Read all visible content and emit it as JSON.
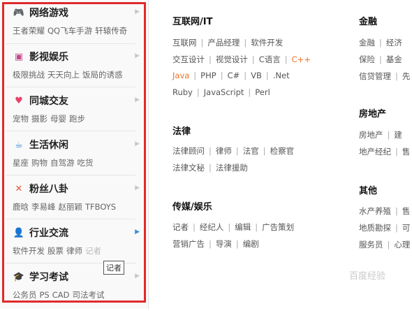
{
  "sidebar": {
    "categories": [
      {
        "title": "网络游戏",
        "subs": [
          "王者荣耀",
          "QQ飞车手游",
          "轩辕传奇"
        ],
        "icon": "gamepad-icon"
      },
      {
        "title": "影视娱乐",
        "subs": [
          "极限挑战",
          "天天向上",
          "饭局的诱惑"
        ],
        "icon": "film-icon"
      },
      {
        "title": "同城交友",
        "subs": [
          "宠物",
          "摄影",
          "母婴",
          "跑步"
        ],
        "icon": "heart-icon"
      },
      {
        "title": "生活休闲",
        "subs": [
          "星座",
          "购物",
          "自驾游",
          "吃货"
        ],
        "icon": "coffee-cup-icon"
      },
      {
        "title": "粉丝八卦",
        "subs": [
          "鹿晗",
          "李易峰",
          "赵丽颖",
          "TFBOYS"
        ],
        "icon": "fan-icon"
      },
      {
        "title": "行业交流",
        "subs": [
          "软件开发",
          "股票",
          "律师",
          "记者"
        ],
        "icon": "person-icon"
      },
      {
        "title": "学习考试",
        "subs": [
          "公务员",
          "PS",
          "CAD",
          "司法考试"
        ],
        "icon": "graduation-cap-icon"
      }
    ],
    "tooltip": "记者",
    "arrow": "▶"
  },
  "panel": {
    "it": {
      "title": "互联网/IT",
      "rows": [
        [
          "互联网",
          "产品经理",
          "软件开发"
        ],
        [
          "交互设计",
          "视觉设计",
          "C语言",
          "C++"
        ],
        [
          "Java",
          "PHP",
          "C#",
          "VB",
          ".Net"
        ],
        [
          "Ruby",
          "JavaScript",
          "Perl"
        ]
      ]
    },
    "law": {
      "title": "法律",
      "rows": [
        [
          "法律顾问",
          "律师",
          "法官",
          "检察官"
        ],
        [
          "法律文秘",
          "法律援助"
        ]
      ]
    },
    "media": {
      "title": "传媒/娱乐",
      "rows": [
        [
          "记者",
          "经纪人",
          "编辑",
          "广告策划"
        ],
        [
          "营销广告",
          "导演",
          "编剧"
        ]
      ]
    },
    "finance": {
      "title": "金融",
      "rows": [
        [
          "金融",
          "经济"
        ],
        [
          "保险",
          "基金"
        ],
        [
          "信贷管理",
          "先"
        ]
      ]
    },
    "realestate": {
      "title": "房地产",
      "rows": [
        [
          "房地产",
          "建"
        ],
        [
          "地产经纪",
          "售"
        ]
      ]
    },
    "other": {
      "title": "其他",
      "rows": [
        [
          "水产养殖",
          "售"
        ],
        [
          "地质勘探",
          "可"
        ],
        [
          "服务员",
          "心理"
        ]
      ]
    }
  },
  "watermark": "百度经验"
}
